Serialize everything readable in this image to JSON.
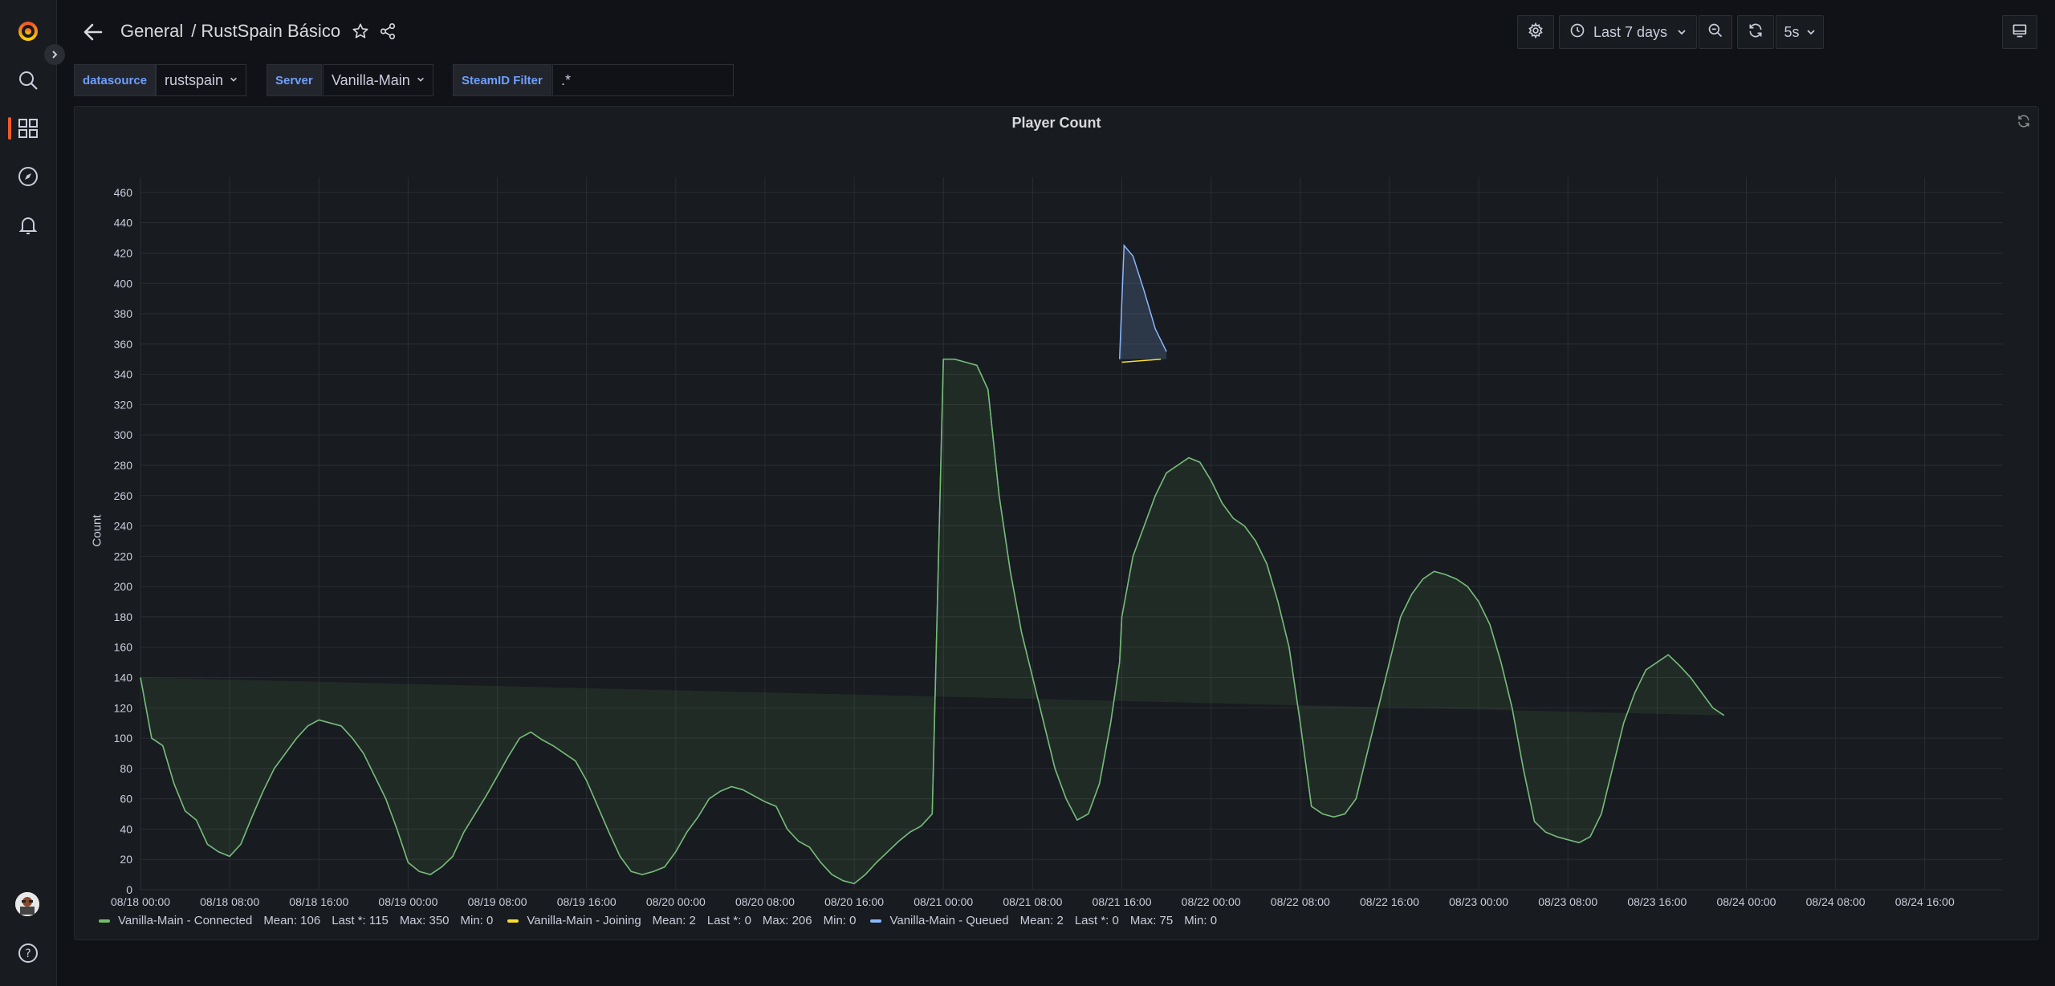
{
  "breadcrumb": {
    "folder": "General",
    "separator": "/",
    "title": "RustSpain Básico"
  },
  "toolbar": {
    "time_range": "Last 7 days",
    "refresh_interval": "5s"
  },
  "variables": [
    {
      "label": "datasource",
      "value": "rustspain"
    },
    {
      "label": "Server",
      "value": "Vanilla-Main"
    },
    {
      "label": "SteamID Filter",
      "value": ".*"
    }
  ],
  "panel": {
    "title": "Player Count"
  },
  "colors": {
    "connected": "#73bf69",
    "joining": "#fade2a",
    "queued": "#8ab8ff",
    "accent": "#f05a28"
  },
  "icons": {
    "sidebar": [
      "grafana-logo-icon",
      "search-icon",
      "dashboards-icon",
      "explore-icon",
      "alerting-icon",
      "avatar",
      "help-icon"
    ],
    "toolbar": [
      "back-arrow-icon",
      "star-icon",
      "share-icon",
      "gear-icon",
      "clock-icon",
      "zoom-out-icon",
      "refresh-icon",
      "tv-mode-icon"
    ]
  },
  "legend": [
    {
      "name": "Vanilla-Main - Connected",
      "mean": "Mean: 106",
      "last": "Last *: 115",
      "max": "Max: 350",
      "min": "Min: 0",
      "color": "#73bf69"
    },
    {
      "name": "Vanilla-Main - Joining",
      "mean": "Mean: 2",
      "last": "Last *: 0",
      "max": "Max: 206",
      "min": "Min: 0",
      "color": "#fade2a"
    },
    {
      "name": "Vanilla-Main - Queued",
      "mean": "Mean: 2",
      "last": "Last *: 0",
      "max": "Max: 75",
      "min": "Min: 0",
      "color": "#8ab8ff"
    }
  ],
  "chart_data": {
    "type": "area",
    "title": "Player Count",
    "xlabel": "",
    "ylabel": "Count",
    "ylim": [
      0,
      470
    ],
    "xlim": [
      -0.0,
      167.0
    ],
    "grid": true,
    "legend_position": "bottom",
    "x_tick_labels": [
      "08/18 00:00",
      "08/18 08:00",
      "08/18 16:00",
      "08/19 00:00",
      "08/19 08:00",
      "08/19 16:00",
      "08/20 00:00",
      "08/20 08:00",
      "08/20 16:00",
      "08/21 00:00",
      "08/21 08:00",
      "08/21 16:00",
      "08/22 00:00",
      "08/22 08:00",
      "08/22 16:00",
      "08/23 00:00",
      "08/23 08:00",
      "08/23 16:00",
      "08/24 00:00",
      "08/24 08:00",
      "08/24 16:00"
    ],
    "x_tick_hours": [
      0,
      8,
      16,
      24,
      32,
      40,
      48,
      56,
      64,
      72,
      80,
      88,
      96,
      104,
      112,
      120,
      128,
      136,
      144,
      152,
      160
    ],
    "y_ticks": [
      0,
      20,
      40,
      60,
      80,
      100,
      120,
      140,
      160,
      180,
      200,
      220,
      240,
      260,
      280,
      300,
      320,
      340,
      360,
      380,
      400,
      420,
      440,
      460
    ],
    "series": [
      {
        "name": "Vanilla-Main - Connected",
        "x_hours": [
          0,
          1,
          2,
          3,
          4,
          5,
          6,
          7,
          8,
          9,
          10,
          11,
          12,
          13,
          14,
          15,
          16,
          17,
          18,
          19,
          20,
          21,
          22,
          23,
          24,
          25,
          26,
          27,
          28,
          29,
          30,
          31,
          32,
          33,
          34,
          35,
          36,
          37,
          38,
          39,
          40,
          41,
          42,
          43,
          44,
          45,
          46,
          47,
          48,
          49,
          50,
          51,
          52,
          53,
          54,
          55,
          56,
          57,
          58,
          59,
          60,
          61,
          62,
          63,
          64,
          65,
          66,
          67,
          68,
          69,
          70,
          71,
          72,
          73,
          74,
          75,
          76,
          77,
          78,
          79,
          80,
          81,
          82,
          83,
          84,
          85,
          86,
          87,
          87.8,
          88,
          89,
          90,
          91,
          92,
          93,
          94,
          95,
          96,
          97,
          98,
          99,
          100,
          101,
          102,
          103,
          104,
          105,
          106,
          107,
          108,
          109,
          110,
          111,
          112,
          113,
          114,
          115,
          116,
          117,
          118,
          119,
          120,
          121,
          122,
          123,
          124,
          125,
          126,
          127,
          128,
          129,
          130,
          131,
          132,
          133,
          134,
          135,
          136,
          137,
          138,
          139,
          140,
          141,
          142,
          143,
          144,
          145,
          146,
          147,
          148,
          149,
          150,
          151,
          152,
          153,
          154,
          155,
          156,
          157,
          158,
          159,
          160,
          161,
          162,
          163,
          164,
          165,
          166,
          167
        ],
        "values": [
          140,
          100,
          95,
          70,
          52,
          46,
          30,
          25,
          22,
          30,
          48,
          65,
          80,
          90,
          100,
          108,
          112,
          110,
          108,
          100,
          90,
          75,
          60,
          40,
          18,
          12,
          10,
          15,
          22,
          38,
          50,
          62,
          75,
          88,
          100,
          104,
          99,
          95,
          90,
          85,
          72,
          55,
          38,
          22,
          12,
          10,
          12,
          15,
          25,
          38,
          48,
          60,
          65,
          68,
          66,
          62,
          58,
          55,
          40,
          32,
          28,
          18,
          10,
          6,
          4,
          10,
          18,
          25,
          32,
          38,
          42,
          50,
          350,
          350,
          348,
          346,
          330,
          260,
          210,
          170,
          140,
          110,
          80,
          60,
          46,
          50,
          70,
          110,
          150,
          180,
          220,
          240,
          260,
          275,
          280,
          285,
          282,
          270,
          255,
          245,
          240,
          230,
          215,
          190,
          160,
          110,
          55,
          50,
          48,
          50,
          60,
          90,
          120,
          150,
          180,
          195,
          205,
          210,
          208,
          205,
          200,
          190,
          175,
          150,
          120,
          80,
          45,
          38,
          35,
          33,
          31,
          35,
          50,
          80,
          110,
          130,
          145,
          150,
          155,
          148,
          140,
          130,
          120,
          115
        ],
        "values_note_skip": true
      }
    ]
  }
}
